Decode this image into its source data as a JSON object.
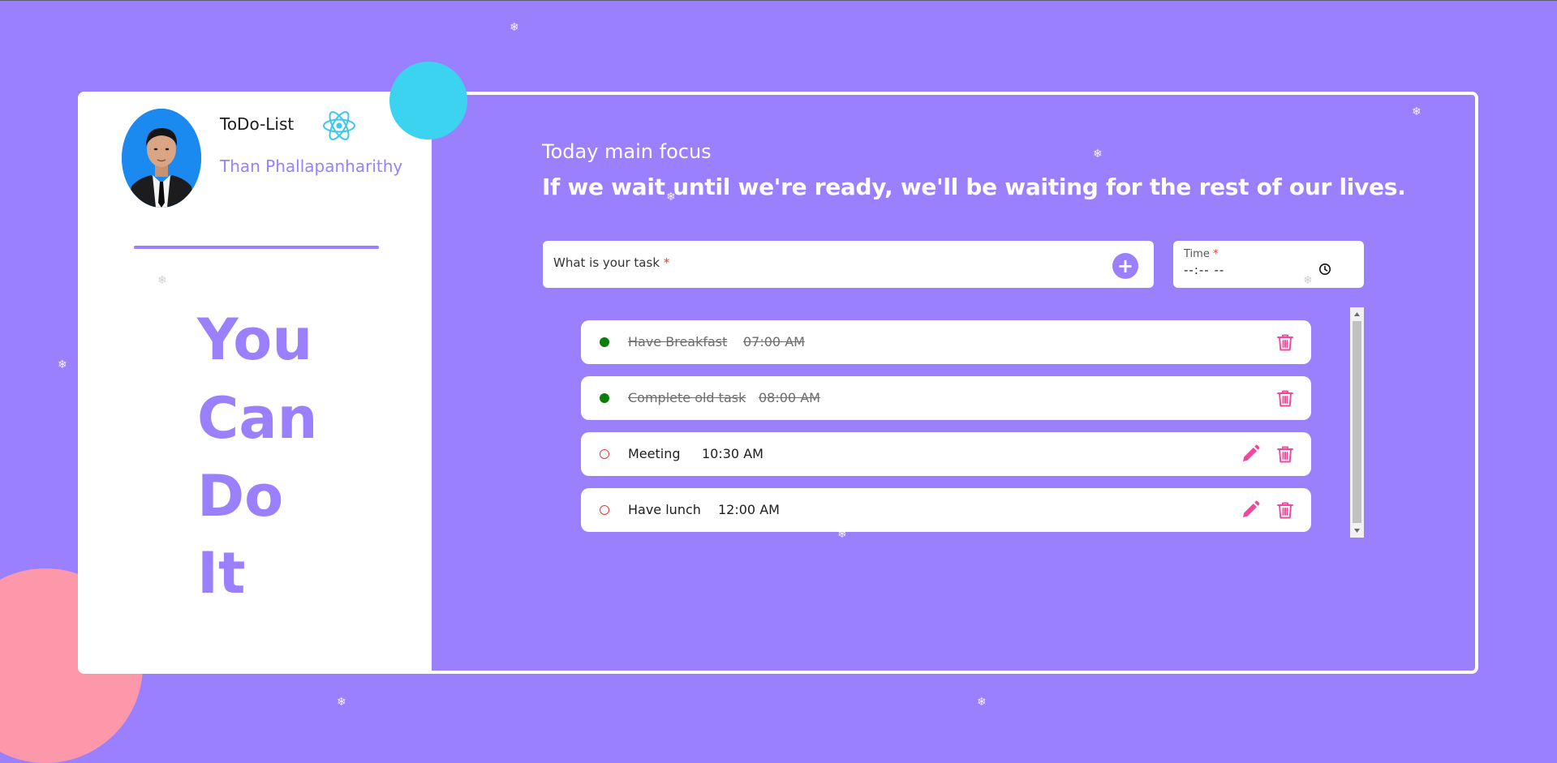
{
  "app": {
    "title": "ToDo-List",
    "user_name": "Than Phallapanharithy"
  },
  "slogan": [
    "You",
    "Can",
    "Do",
    "It"
  ],
  "focus": {
    "label": "Today main focus",
    "quote": "If we wait until we're ready, we'll be waiting for the rest of our lives."
  },
  "form": {
    "task_label": "What is your task",
    "time_label": "Time",
    "required_mark": "*",
    "time_value": "--:-- --",
    "add_button_label": "+"
  },
  "tasks": [
    {
      "name": "Have Breakfast",
      "time": "07:00 AM",
      "completed": true
    },
    {
      "name": "Complete old task",
      "time": "08:00 AM",
      "completed": true
    },
    {
      "name": "Meeting",
      "time": "10:30 AM",
      "completed": false
    },
    {
      "name": "Have lunch",
      "time": "12:00 AM",
      "completed": false
    }
  ],
  "colors": {
    "background": "#9a80fd",
    "accent": "#9a80fd",
    "action_icon": "#f0489c",
    "done_dot": "#0a7d0a",
    "open_dot": "#e53935",
    "cyan_blob": "#3cd3f0",
    "pink_blob": "#fd97aa"
  },
  "icons": {
    "react": "react-icon",
    "add": "plus-icon",
    "clock": "clock-icon",
    "edit": "pencil-icon",
    "delete": "trash-icon",
    "snow": "snowflake-icon"
  }
}
